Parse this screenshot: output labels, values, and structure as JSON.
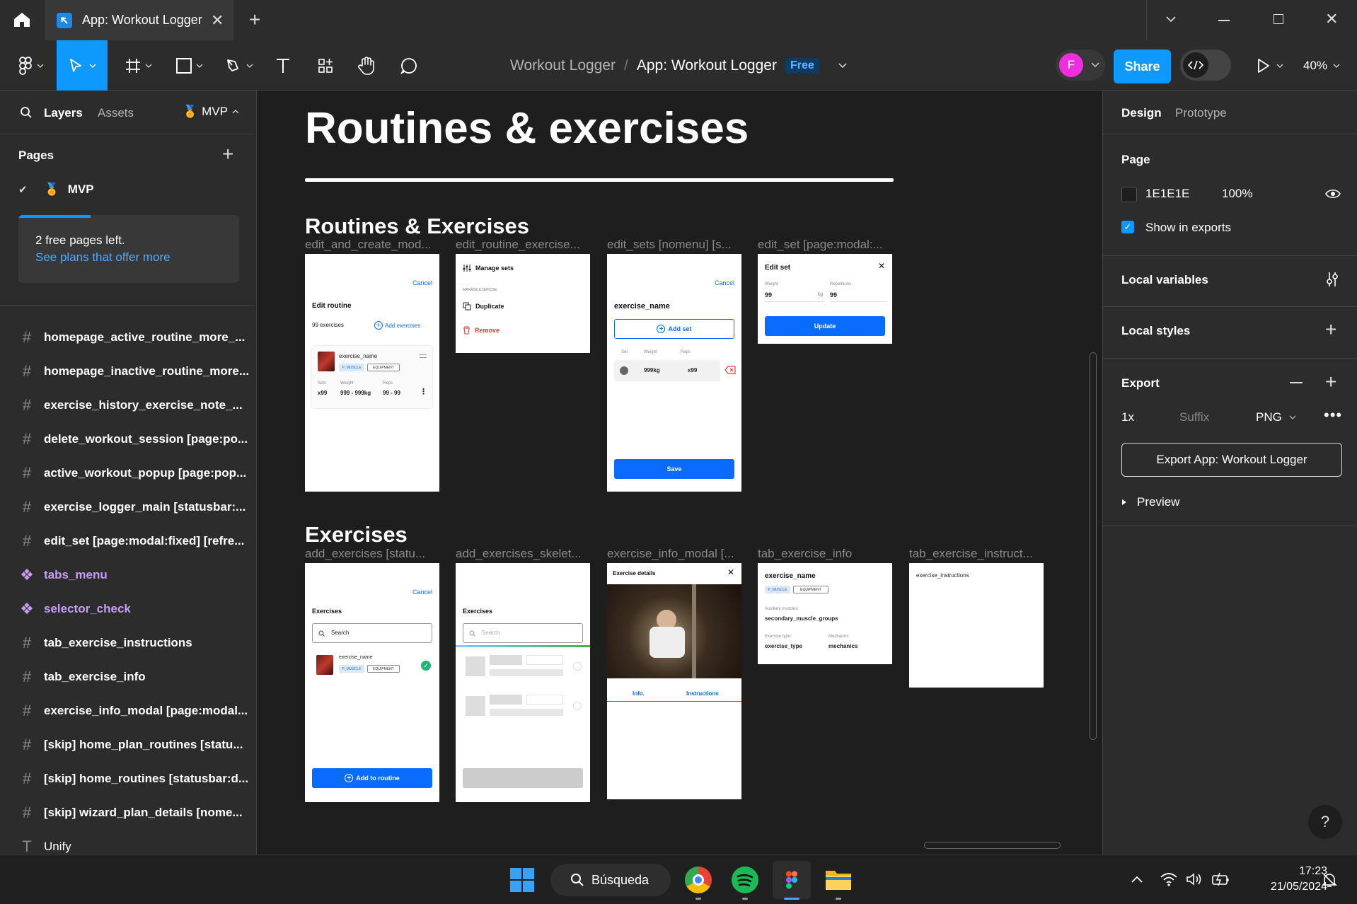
{
  "titlebar": {
    "tab_title": "App: Workout Logger"
  },
  "toolbar": {
    "breadcrumb_project": "Workout Logger",
    "breadcrumb_sep": "/",
    "breadcrumb_file": "App: Workout Logger",
    "plan_badge": "Free",
    "avatar_letter": "F",
    "share_label": "Share",
    "zoom": "40%"
  },
  "left_panel": {
    "tab_layers": "Layers",
    "tab_assets": "Assets",
    "page_selector": "MVP",
    "pages_heading": "Pages",
    "current_page": "MVP",
    "notice_text": "2 free pages left.",
    "notice_link": "See plans that offer more",
    "layers": [
      {
        "type": "frame",
        "label": "homepage_active_routine_more_..."
      },
      {
        "type": "frame",
        "label": "homepage_inactive_routine_more..."
      },
      {
        "type": "frame",
        "label": "exercise_history_exercise_note_..."
      },
      {
        "type": "frame",
        "label": "delete_workout_session [page:po..."
      },
      {
        "type": "frame",
        "label": "active_workout_popup [page:pop..."
      },
      {
        "type": "frame",
        "label": "exercise_logger_main [statusbar:..."
      },
      {
        "type": "frame",
        "label": "edit_set [page:modal:fixed] [refre..."
      },
      {
        "type": "component",
        "label": "tabs_menu"
      },
      {
        "type": "component",
        "label": "selector_check"
      },
      {
        "type": "frame",
        "label": "tab_exercise_instructions"
      },
      {
        "type": "frame",
        "label": "tab_exercise_info"
      },
      {
        "type": "frame",
        "label": "exercise_info_modal [page:modal..."
      },
      {
        "type": "frame",
        "label": "[skip] home_plan_routines [statu..."
      },
      {
        "type": "frame",
        "label": "[skip] home_routines [statusbar:d..."
      },
      {
        "type": "frame",
        "label": "[skip] wizard_plan_details [nome..."
      },
      {
        "type": "text",
        "label": "Unify"
      }
    ]
  },
  "canvas": {
    "heading": "Routines & exercises",
    "section1": "Routines & Exercises",
    "section2": "Exercises",
    "frame_labels": {
      "f1": "edit_and_create_mod...",
      "f2": "edit_routine_exercise...",
      "f3": "edit_sets [nomenu] [s...",
      "f4": "edit_set [page:modal:...",
      "f5": "add_exercises [statu...",
      "f6": "add_exercises_skelet...",
      "f7": "exercise_info_modal [...",
      "f8": "tab_exercise_info",
      "f9": "tab_exercise_instruct..."
    },
    "f1": {
      "cancel": "Cancel",
      "title": "Edit routine",
      "count": "99 exercises",
      "add": "Add exercises",
      "exercise_name": "exercise_name",
      "muscle": "P_MUSCLE",
      "equipment": "EQUIPMENT",
      "col_sets": "Sets",
      "col_weight": "Weight",
      "col_reps": "Reps",
      "v_sets": "x99",
      "v_weight": "999 - 999kg",
      "v_reps": "99 - 99"
    },
    "f2": {
      "manage": "Manage sets",
      "section": "MANAGE EXERCISE",
      "duplicate": "Duplicate",
      "remove": "Remove"
    },
    "f3": {
      "cancel": "Cancel",
      "title": "exercise_name",
      "add_set": "Add set",
      "col_set": "Set",
      "col_weight": "Weight",
      "col_reps": "Reps",
      "v_weight": "999kg",
      "v_reps": "x99",
      "save": "Save"
    },
    "f4": {
      "title": "Edit set",
      "weight_label": "Weight",
      "reps_label": "Repetitions",
      "weight": "99",
      "unit": "kg",
      "reps": "99",
      "update": "Update"
    },
    "f5": {
      "cancel": "Cancel",
      "title": "Exercises",
      "search": "Search",
      "exercise_name": "exercise_name",
      "muscle": "P_MUSCLE",
      "equipment": "EQUIPMENT",
      "add": "Add to routine"
    },
    "f6": {
      "title": "Exercises",
      "search": "Search"
    },
    "f7": {
      "title": "Exercise details",
      "tab_info": "Info.",
      "tab_instructions": "Instructions"
    },
    "f8": {
      "name": "exercise_name",
      "muscle": "P_MUSCLE",
      "equipment": "EQUIPMENT",
      "aux_label": "Auxiliary muscles:",
      "aux_value": "secondary_muscle_groups",
      "type_label": "Exercise type:",
      "type_value": "exercise_type",
      "mech_label": "Mechanics",
      "mech_value": "mechanics"
    },
    "f9": {
      "text": "exercise_instructions"
    }
  },
  "right_panel": {
    "tab_design": "Design",
    "tab_prototype": "Prototype",
    "page_heading": "Page",
    "page_color": "1E1E1E",
    "page_opacity": "100%",
    "show_in_exports": "Show in exports",
    "local_variables": "Local variables",
    "local_styles": "Local styles",
    "export_heading": "Export",
    "export_scale": "1x",
    "export_suffix_placeholder": "Suffix",
    "export_format": "PNG",
    "export_button": "Export App: Workout Logger",
    "preview": "Preview"
  },
  "taskbar": {
    "search": "Búsqueda",
    "time": "17:23",
    "date": "21/05/2024"
  },
  "colors": {
    "accent": "#0d99ff",
    "canvas": "#1E1E1E",
    "avatar": "#f02ee0"
  }
}
